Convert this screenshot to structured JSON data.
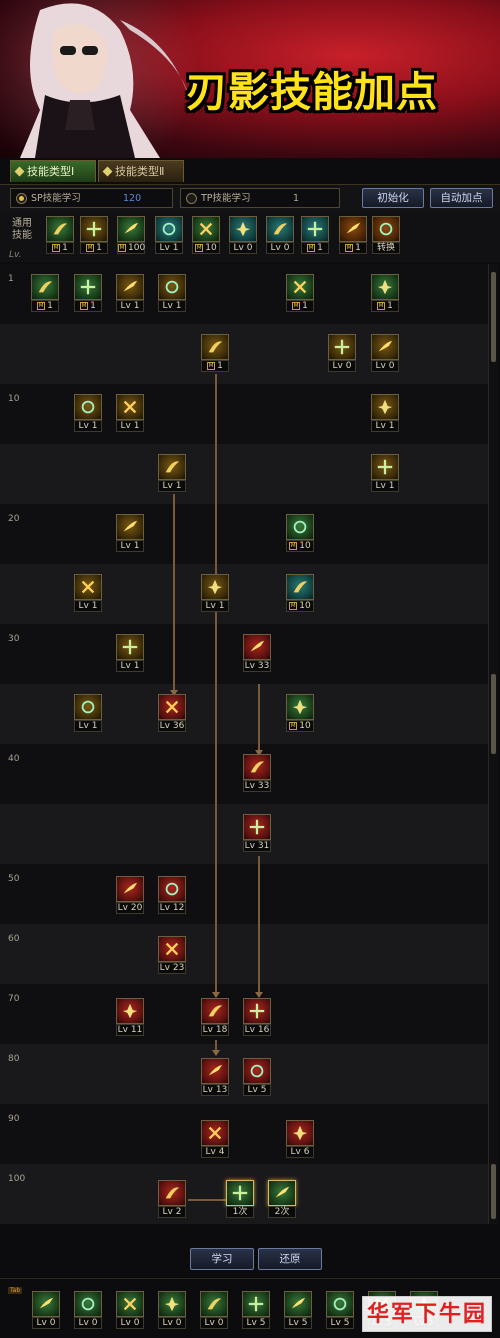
{
  "banner": {
    "title": "刃影技能加点"
  },
  "tabs": [
    {
      "label": "技能类型Ⅰ",
      "active": true
    },
    {
      "label": "技能类型Ⅱ",
      "active": false
    }
  ],
  "points": {
    "sp": {
      "label": "SP技能学习",
      "value": "120"
    },
    "tp": {
      "label": "TP技能学习",
      "value": "1"
    }
  },
  "buttons": {
    "reset": "初始化",
    "auto": "自动加点",
    "learn": "学习",
    "restore": "还原"
  },
  "common": {
    "label": "通用技能",
    "lv_label": "Lv.",
    "skills": [
      {
        "cap": "1",
        "m": true,
        "color": "g"
      },
      {
        "cap": "1",
        "m": true,
        "color": "y"
      },
      {
        "cap": "100",
        "m": true,
        "color": "g"
      },
      {
        "cap": "Lv 1",
        "m": false,
        "color": "t"
      },
      {
        "cap": "10",
        "m": true,
        "color": "g"
      },
      {
        "cap": "Lv 0",
        "m": false,
        "color": "t"
      },
      {
        "cap": "Lv 0",
        "m": false,
        "color": "t"
      },
      {
        "cap": "1",
        "m": true,
        "color": "t"
      },
      {
        "cap": "1",
        "m": true,
        "color": "o"
      },
      {
        "cap": "转换",
        "m": false,
        "color": "o"
      }
    ]
  },
  "tree": {
    "level_labels": [
      "1",
      "10",
      "20",
      "30",
      "40",
      "50",
      "60",
      "70",
      "80",
      "90",
      "100"
    ],
    "skills": [
      {
        "cap": "1",
        "m": true,
        "color": "g"
      },
      {
        "cap": "1",
        "m": true,
        "color": "g"
      },
      {
        "cap": "Lv 1",
        "m": false,
        "color": "y"
      },
      {
        "cap": "Lv 1",
        "m": false,
        "color": "y"
      },
      {
        "cap": "1",
        "m": true,
        "color": "g"
      },
      {
        "cap": "1",
        "m": true,
        "color": "g"
      },
      {
        "cap": "1",
        "m": true,
        "color": "y"
      },
      {
        "cap": "Lv 0",
        "m": false,
        "color": "y"
      },
      {
        "cap": "Lv 0",
        "m": false,
        "color": "y"
      },
      {
        "cap": "Lv 1",
        "m": false,
        "color": "y"
      },
      {
        "cap": "Lv 1",
        "m": false,
        "color": "y"
      },
      {
        "cap": "Lv 1",
        "m": false,
        "color": "y"
      },
      {
        "cap": "Lv 1",
        "m": false,
        "color": "y"
      },
      {
        "cap": "Lv 1",
        "m": false,
        "color": "y"
      },
      {
        "cap": "Lv 1",
        "m": false,
        "color": "y"
      },
      {
        "cap": "10",
        "m": true,
        "color": "g"
      },
      {
        "cap": "Lv 1",
        "m": false,
        "color": "y"
      },
      {
        "cap": "Lv 1",
        "m": false,
        "color": "y"
      },
      {
        "cap": "10",
        "m": true,
        "color": "t"
      },
      {
        "cap": "Lv 1",
        "m": false,
        "color": "y"
      },
      {
        "cap": "Lv 33",
        "m": false,
        "color": "r"
      },
      {
        "cap": "Lv 1",
        "m": false,
        "color": "y"
      },
      {
        "cap": "Lv 36",
        "m": false,
        "color": "r"
      },
      {
        "cap": "10",
        "m": true,
        "color": "g"
      },
      {
        "cap": "Lv 33",
        "m": false,
        "color": "r"
      },
      {
        "cap": "Lv 31",
        "m": false,
        "color": "r"
      },
      {
        "cap": "Lv 20",
        "m": false,
        "color": "r"
      },
      {
        "cap": "Lv 12",
        "m": false,
        "color": "r"
      },
      {
        "cap": "Lv 23",
        "m": false,
        "color": "r"
      },
      {
        "cap": "Lv 11",
        "m": false,
        "color": "r"
      },
      {
        "cap": "Lv 18",
        "m": false,
        "color": "r"
      },
      {
        "cap": "Lv 16",
        "m": false,
        "color": "r"
      },
      {
        "cap": "Lv 13",
        "m": false,
        "color": "r"
      },
      {
        "cap": "Lv 5",
        "m": false,
        "color": "r"
      },
      {
        "cap": "Lv 4",
        "m": false,
        "color": "r"
      },
      {
        "cap": "Lv 6",
        "m": false,
        "color": "r"
      },
      {
        "cap": "Lv 2",
        "m": false,
        "color": "r"
      },
      {
        "cap": "1次",
        "m": false,
        "color": "g"
      },
      {
        "cap": "2次",
        "m": false,
        "color": "g"
      }
    ]
  },
  "quickbar": {
    "skills": [
      {
        "cap": "Lv 0",
        "color": "g"
      },
      {
        "cap": "Lv 0",
        "color": "g"
      },
      {
        "cap": "Lv 0",
        "color": "g"
      },
      {
        "cap": "Lv 0",
        "color": "g"
      },
      {
        "cap": "Lv 0",
        "color": "g"
      },
      {
        "cap": "Lv 5",
        "color": "g"
      },
      {
        "cap": "Lv 5",
        "color": "g"
      },
      {
        "cap": "Lv 5",
        "color": "g"
      },
      {
        "cap": "Lv 5",
        "color": "g"
      },
      {
        "cap": "Lv 5",
        "color": "g"
      }
    ]
  },
  "watermark": "华军下牛园"
}
